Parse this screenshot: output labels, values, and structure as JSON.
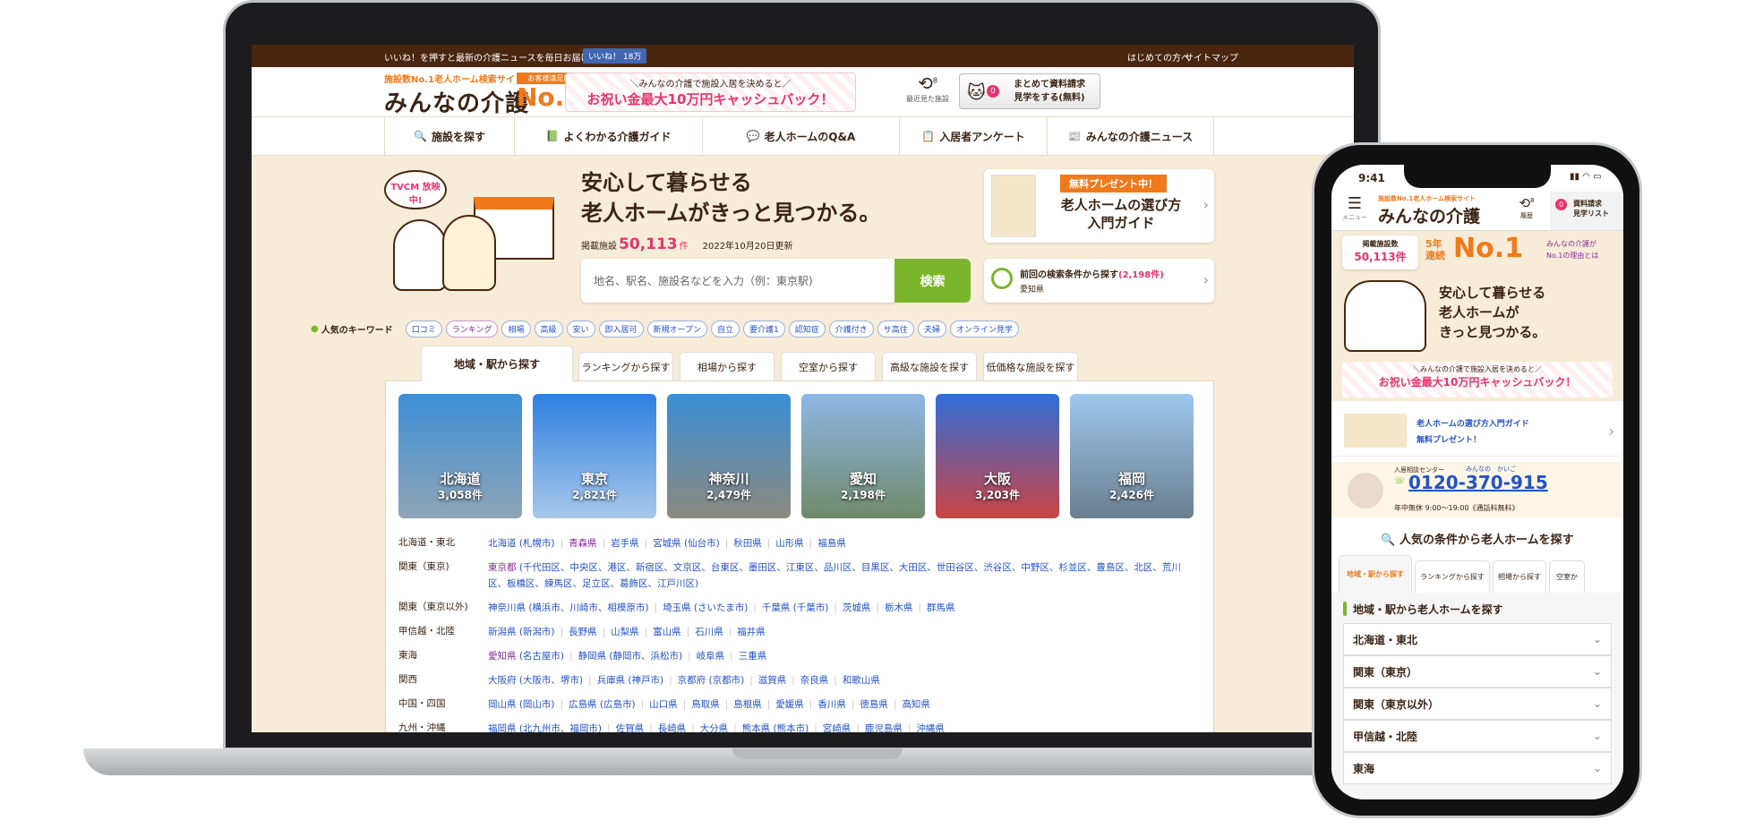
{
  "site": {
    "topbar": {
      "message": "いいね！を押すと最新の介護ニュースを毎日お届け",
      "like_label": "いいね！ 18万",
      "links": [
        "はじめての方へ",
        "サイトマップ"
      ]
    },
    "logo": {
      "tagline": "施設数No.1老人ホーム検索サイト",
      "name": "みんなの介護",
      "badge_top": "お客様満足度",
      "badge": "No.1"
    },
    "banner": {
      "line1": "＼みんなの介護で施設入居を決めると／",
      "line2": "お祝い金最大10万円キャッシュバック！"
    },
    "history": {
      "count": "8",
      "label": "最近見た施設"
    },
    "request": {
      "count": "0",
      "label": "まとめて資料請求\n見学をする(無料)"
    },
    "nav": [
      "施設を探す",
      "よくわかる介護ガイド",
      "老人ホームのQ&A",
      "入居者アンケート",
      "みんなの介護ニュース"
    ],
    "hero": {
      "tvcm": "TVCM 放映中!",
      "headline1": "安心して暮らせる",
      "headline2": "老人ホームがきっと見つかる。",
      "count_label": "掲載施設",
      "count": "50,113",
      "count_unit": "件",
      "updated": "2022年10月20日更新"
    },
    "search": {
      "placeholder": "地名、駅名、施設名などを入力（例：東京駅)",
      "button": "検索"
    },
    "guide_card": {
      "badge": "無料プレゼント中！",
      "title1": "老人ホームの選び方",
      "title2": "入門ガイド"
    },
    "last_search": {
      "label": "前回の検索条件から探す",
      "count": "(2,198件)",
      "sub": "愛知県"
    },
    "keywords": {
      "label": "人気のキーワード",
      "items": [
        "口コミ",
        "ランキング",
        "相場",
        "高級",
        "安い",
        "即入居可",
        "新規オープン",
        "自立",
        "要介護1",
        "認知症",
        "介護付き",
        "サ高住",
        "夫婦",
        "オンライン見学"
      ]
    },
    "tabs": [
      "地域・駅から探す",
      "ランキングから探す",
      "相場から探す",
      "空室から探す",
      "高級な施設を探す",
      "低価格な施設を探す"
    ],
    "areas": [
      {
        "name": "北海道",
        "count": "3,058件"
      },
      {
        "name": "東京",
        "count": "2,821件"
      },
      {
        "name": "神奈川",
        "count": "2,479件"
      },
      {
        "name": "愛知",
        "count": "2,198件"
      },
      {
        "name": "大阪",
        "count": "3,203件"
      },
      {
        "name": "福岡",
        "count": "2,426件"
      }
    ],
    "regions": [
      {
        "label": "北海道・東北",
        "links": [
          {
            "t": "北海道",
            "s": "(札幌市)"
          },
          {
            "t": "青森県",
            "v": true
          },
          {
            "t": "岩手県"
          },
          {
            "t": "宮城県",
            "s": "(仙台市)"
          },
          {
            "t": "秋田県"
          },
          {
            "t": "山形県"
          },
          {
            "t": "福島県"
          }
        ]
      },
      {
        "label": "関東（東京)",
        "links": [
          {
            "t": "東京都",
            "v": true,
            "s": "(千代田区、中央区、港区、新宿区、文京区、台東区、墨田区、江東区、品川区、目黒区、大田区、世田谷区、渋谷区、中野区、杉並区、豊島区、北区、荒川区、板橋区、練馬区、足立区、葛飾区、江戸川区)"
          }
        ]
      },
      {
        "label": "関東（東京以外)",
        "links": [
          {
            "t": "神奈川県",
            "s": "(横浜市、川崎市、相模原市)"
          },
          {
            "t": "埼玉県",
            "s": "(さいたま市)"
          },
          {
            "t": "千葉県",
            "s": "(千葉市)"
          },
          {
            "t": "茨城県"
          },
          {
            "t": "栃木県"
          },
          {
            "t": "群馬県"
          }
        ]
      },
      {
        "label": "甲信越・北陸",
        "links": [
          {
            "t": "新潟県",
            "s": "(新潟市)"
          },
          {
            "t": "長野県"
          },
          {
            "t": "山梨県"
          },
          {
            "t": "富山県"
          },
          {
            "t": "石川県"
          },
          {
            "t": "福井県"
          }
        ]
      },
      {
        "label": "東海",
        "links": [
          {
            "t": "愛知県",
            "v": true,
            "s": "(名古屋市)"
          },
          {
            "t": "静岡県",
            "s": "(静岡市、浜松市)"
          },
          {
            "t": "岐阜県"
          },
          {
            "t": "三重県"
          }
        ]
      },
      {
        "label": "関西",
        "links": [
          {
            "t": "大阪府",
            "s": "(大阪市、堺市)"
          },
          {
            "t": "兵庫県",
            "s": "(神戸市)"
          },
          {
            "t": "京都府",
            "s": "(京都市)"
          },
          {
            "t": "滋賀県"
          },
          {
            "t": "奈良県"
          },
          {
            "t": "和歌山県"
          }
        ]
      },
      {
        "label": "中国・四国",
        "links": [
          {
            "t": "岡山県",
            "s": "(岡山市)"
          },
          {
            "t": "広島県",
            "s": "(広島市)"
          },
          {
            "t": "山口県"
          },
          {
            "t": "鳥取県"
          },
          {
            "t": "島根県"
          },
          {
            "t": "愛媛県"
          },
          {
            "t": "香川県"
          },
          {
            "t": "徳島県"
          },
          {
            "t": "高知県"
          }
        ]
      },
      {
        "label": "九州・沖縄",
        "links": [
          {
            "t": "福岡県",
            "s": "(北九州市、福岡市)"
          },
          {
            "t": "佐賀県"
          },
          {
            "t": "長崎県"
          },
          {
            "t": "大分県"
          },
          {
            "t": "熊本県",
            "s": "(熊本市)"
          },
          {
            "t": "宮崎県"
          },
          {
            "t": "鹿児島県"
          },
          {
            "t": "沖縄県"
          }
        ]
      }
    ]
  },
  "mobile": {
    "time": "9:41",
    "menu": "メニュー",
    "history": {
      "count": "8",
      "label": "履歴"
    },
    "request": {
      "count": "0",
      "label": "資料請求\n見学リスト"
    },
    "listing": {
      "label": "掲載施設数",
      "count": "50,113件"
    },
    "no1": {
      "years": "5年\n連続",
      "badge": "No.1",
      "reason": "みんなの介護が\nNo.1の理由とは"
    },
    "headline": "安心して暮らせる\n老人ホームが\nきっと見つかる。",
    "guide": {
      "line1": "老人ホームの選び方入門ガイド",
      "line2": "無料プレゼント！"
    },
    "call": {
      "center": "入居相談センター",
      "ruby": "みんなの　かいご",
      "phone": "0120-370-915",
      "hours": "年中無休 9:00～19:00《通話料無料》"
    },
    "search_title": "人気の条件から老人ホームを探す",
    "tabs": [
      "地域・駅から探す",
      "ランキングから探す",
      "相場から探す",
      "空室か"
    ],
    "section": "地域・駅から老人ホームを探す",
    "accordion": [
      "北海道・東北",
      "関東（東京）",
      "関東（東京以外）",
      "甲信越・北陸",
      "東海"
    ]
  },
  "colors": {
    "brand_brown": "#4a2610",
    "accent_orange": "#f07a1a",
    "search_green": "#7bb52c",
    "link_blue": "#2452c6",
    "visited_purple": "#8a2a9a",
    "count_pink": "#e8336e",
    "hero_bg": "#f7ecd8"
  }
}
